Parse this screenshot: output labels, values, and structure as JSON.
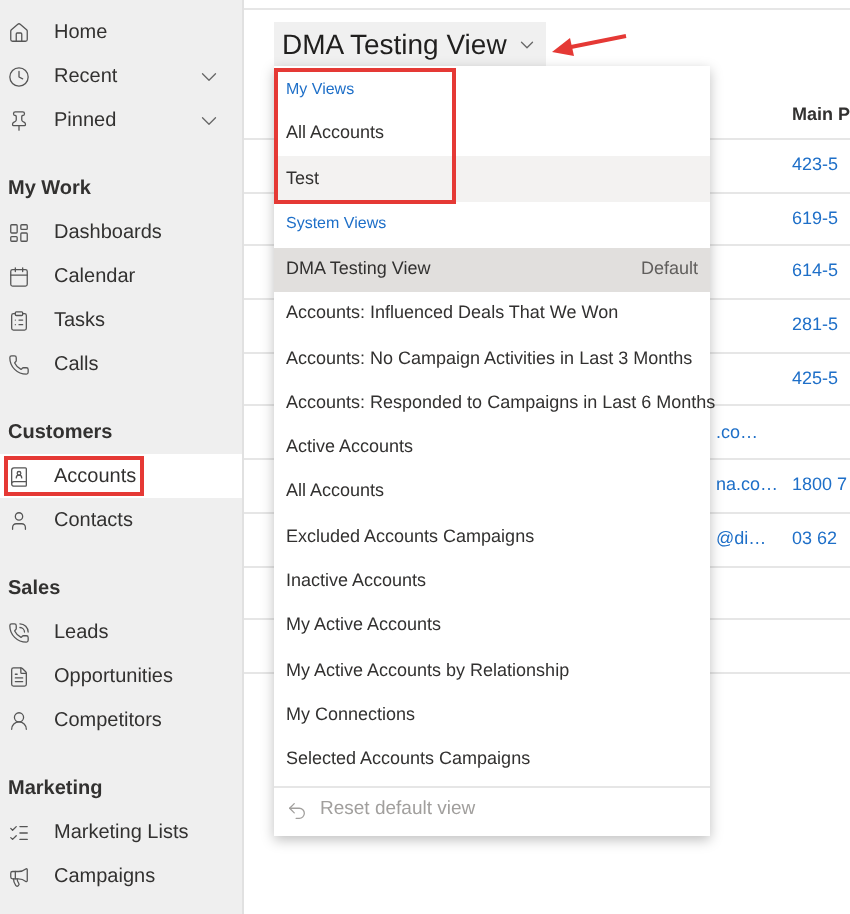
{
  "sidebar": {
    "sections": [
      {
        "items": [
          {
            "label": "Home",
            "selected": false
          },
          {
            "label": "Recent",
            "selected": false,
            "expandable": true
          },
          {
            "label": "Pinned",
            "selected": false,
            "expandable": true
          }
        ]
      },
      {
        "heading": "My Work",
        "items": [
          {
            "label": "Dashboards",
            "selected": false
          },
          {
            "label": "Calendar",
            "selected": false
          },
          {
            "label": "Tasks",
            "selected": false
          },
          {
            "label": "Calls",
            "selected": false
          }
        ]
      },
      {
        "heading": "Customers",
        "items": [
          {
            "label": "Accounts",
            "selected": true,
            "outlined": true
          },
          {
            "label": "Contacts",
            "selected": false
          }
        ]
      },
      {
        "heading": "Sales",
        "items": [
          {
            "label": "Leads",
            "selected": false
          },
          {
            "label": "Opportunities",
            "selected": false
          },
          {
            "label": "Competitors",
            "selected": false
          }
        ]
      },
      {
        "heading": "Marketing",
        "items": [
          {
            "label": "Marketing Lists",
            "selected": false
          },
          {
            "label": "Campaigns",
            "selected": false
          }
        ]
      }
    ]
  },
  "view_selector": {
    "title": "DMA Testing View",
    "arrow": true
  },
  "grid": {
    "columns": [
      {
        "label": "Main P"
      }
    ],
    "rows": [
      {
        "main_phone": "423-5"
      },
      {
        "main_phone": "619-5"
      },
      {
        "main_phone": "614-5"
      },
      {
        "main_phone": "281-5"
      },
      {
        "main_phone": "425-5"
      },
      {
        "column_1": ".co…"
      },
      {
        "column_1": "na.co…",
        "main_phone": "1800 7"
      },
      {
        "column_1": "@di…",
        "main_phone": "03 62"
      }
    ]
  },
  "view_menu": {
    "groups": [
      {
        "heading": "My Views",
        "outlined": true,
        "items": [
          {
            "label": "All Accounts",
            "selected": false
          },
          {
            "label": "Test",
            "selected": false,
            "hovered": true
          }
        ]
      },
      {
        "heading": "System Views",
        "items": [
          {
            "label": "DMA Testing View",
            "selected": true,
            "badge": "Default"
          },
          {
            "label": "Accounts: Influenced Deals That We Won",
            "selected": false
          },
          {
            "label": "Accounts: No Campaign Activities in Last 3 Months",
            "selected": false
          },
          {
            "label": "Accounts: Responded to Campaigns in Last 6 Months",
            "selected": false
          },
          {
            "label": "Active Accounts",
            "selected": false
          },
          {
            "label": "All Accounts",
            "selected": false
          },
          {
            "label": "Excluded Accounts Campaigns",
            "selected": false
          },
          {
            "label": "Inactive Accounts",
            "selected": false
          },
          {
            "label": "My Active Accounts",
            "selected": false
          },
          {
            "label": "My Active Accounts by Relationship",
            "selected": false
          },
          {
            "label": "My Connections",
            "selected": false
          },
          {
            "label": "Selected Accounts Campaigns",
            "selected": false
          }
        ]
      }
    ],
    "reset": {
      "label": "Reset default view",
      "disabled": true
    }
  }
}
